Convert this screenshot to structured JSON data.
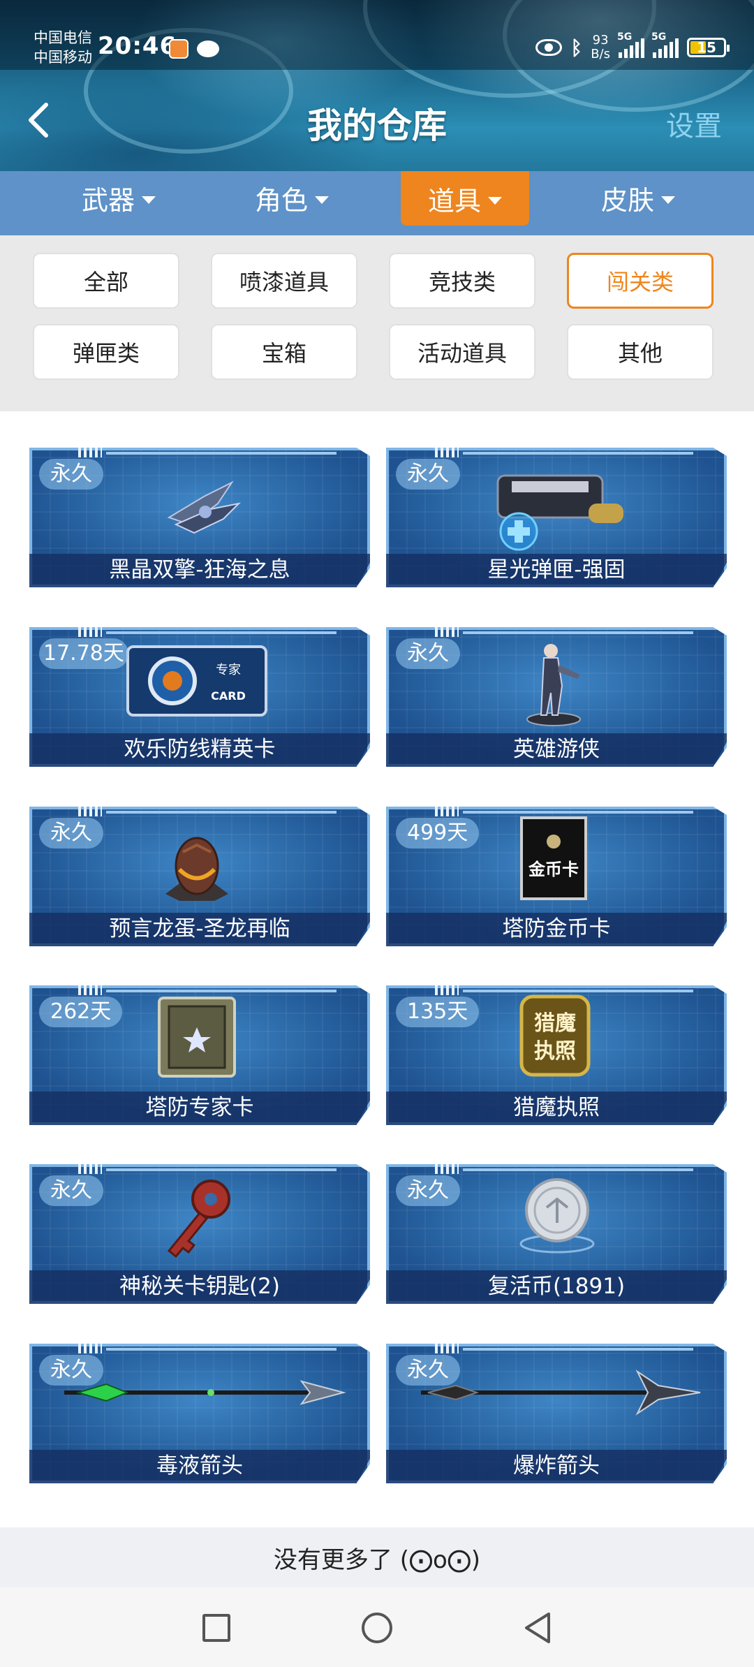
{
  "status": {
    "carrier_1": "中国电信",
    "carrier_2": "中国移动",
    "time": "20:46",
    "net_speed_value": "93",
    "net_speed_unit": "B/s",
    "signal_1": "5G",
    "signal_2": "5G",
    "battery": "15"
  },
  "header": {
    "title": "我的仓库",
    "settings": "设置"
  },
  "categories": [
    {
      "label": "武器",
      "active": false
    },
    {
      "label": "角色",
      "active": false
    },
    {
      "label": "道具",
      "active": true
    },
    {
      "label": "皮肤",
      "active": false
    }
  ],
  "filters": [
    {
      "label": "全部",
      "active": false
    },
    {
      "label": "喷漆道具",
      "active": false
    },
    {
      "label": "竞技类",
      "active": false
    },
    {
      "label": "闯关类",
      "active": true
    },
    {
      "label": "弹匣类",
      "active": false
    },
    {
      "label": "宝箱",
      "active": false
    },
    {
      "label": "活动道具",
      "active": false
    },
    {
      "label": "其他",
      "active": false
    }
  ],
  "items": [
    {
      "name": "黑晶双擎-狂海之息",
      "duration": "永久",
      "icon": "dual-blade-icon"
    },
    {
      "name": "星光弹匣-强固",
      "duration": "永久",
      "icon": "magazine-icon"
    },
    {
      "name": "欢乐防线精英卡",
      "duration": "17.78天",
      "icon": "expert-card-icon"
    },
    {
      "name": "英雄游侠",
      "duration": "永久",
      "icon": "hero-figure-icon"
    },
    {
      "name": "预言龙蛋-圣龙再临",
      "duration": "永久",
      "icon": "dragon-egg-icon"
    },
    {
      "name": "塔防金币卡",
      "duration": "499天",
      "icon": "gold-card-icon"
    },
    {
      "name": "塔防专家卡",
      "duration": "262天",
      "icon": "expert-crate-icon"
    },
    {
      "name": "猎魔执照",
      "duration": "135天",
      "icon": "hunter-license-icon"
    },
    {
      "name": "神秘关卡钥匙(2)",
      "duration": "永久",
      "icon": "key-icon"
    },
    {
      "name": "复活币(1891)",
      "duration": "永久",
      "icon": "revive-coin-icon"
    },
    {
      "name": "毒液箭头",
      "duration": "永久",
      "icon": "venom-arrow-icon"
    },
    {
      "name": "爆炸箭头",
      "duration": "永久",
      "icon": "explosive-arrow-icon"
    }
  ],
  "item_art": {
    "expert_card_top": "专家",
    "expert_card_bottom": "CARD",
    "gold_card": "金币卡",
    "hunter_top": "猎魔",
    "hunter_bottom": "执照"
  },
  "footer": {
    "no_more": "没有更多了 (⨀o⨀)"
  },
  "colors": {
    "accent": "#ee851e",
    "category_bar": "#5e92c8",
    "settings": "#8fd3ef"
  }
}
